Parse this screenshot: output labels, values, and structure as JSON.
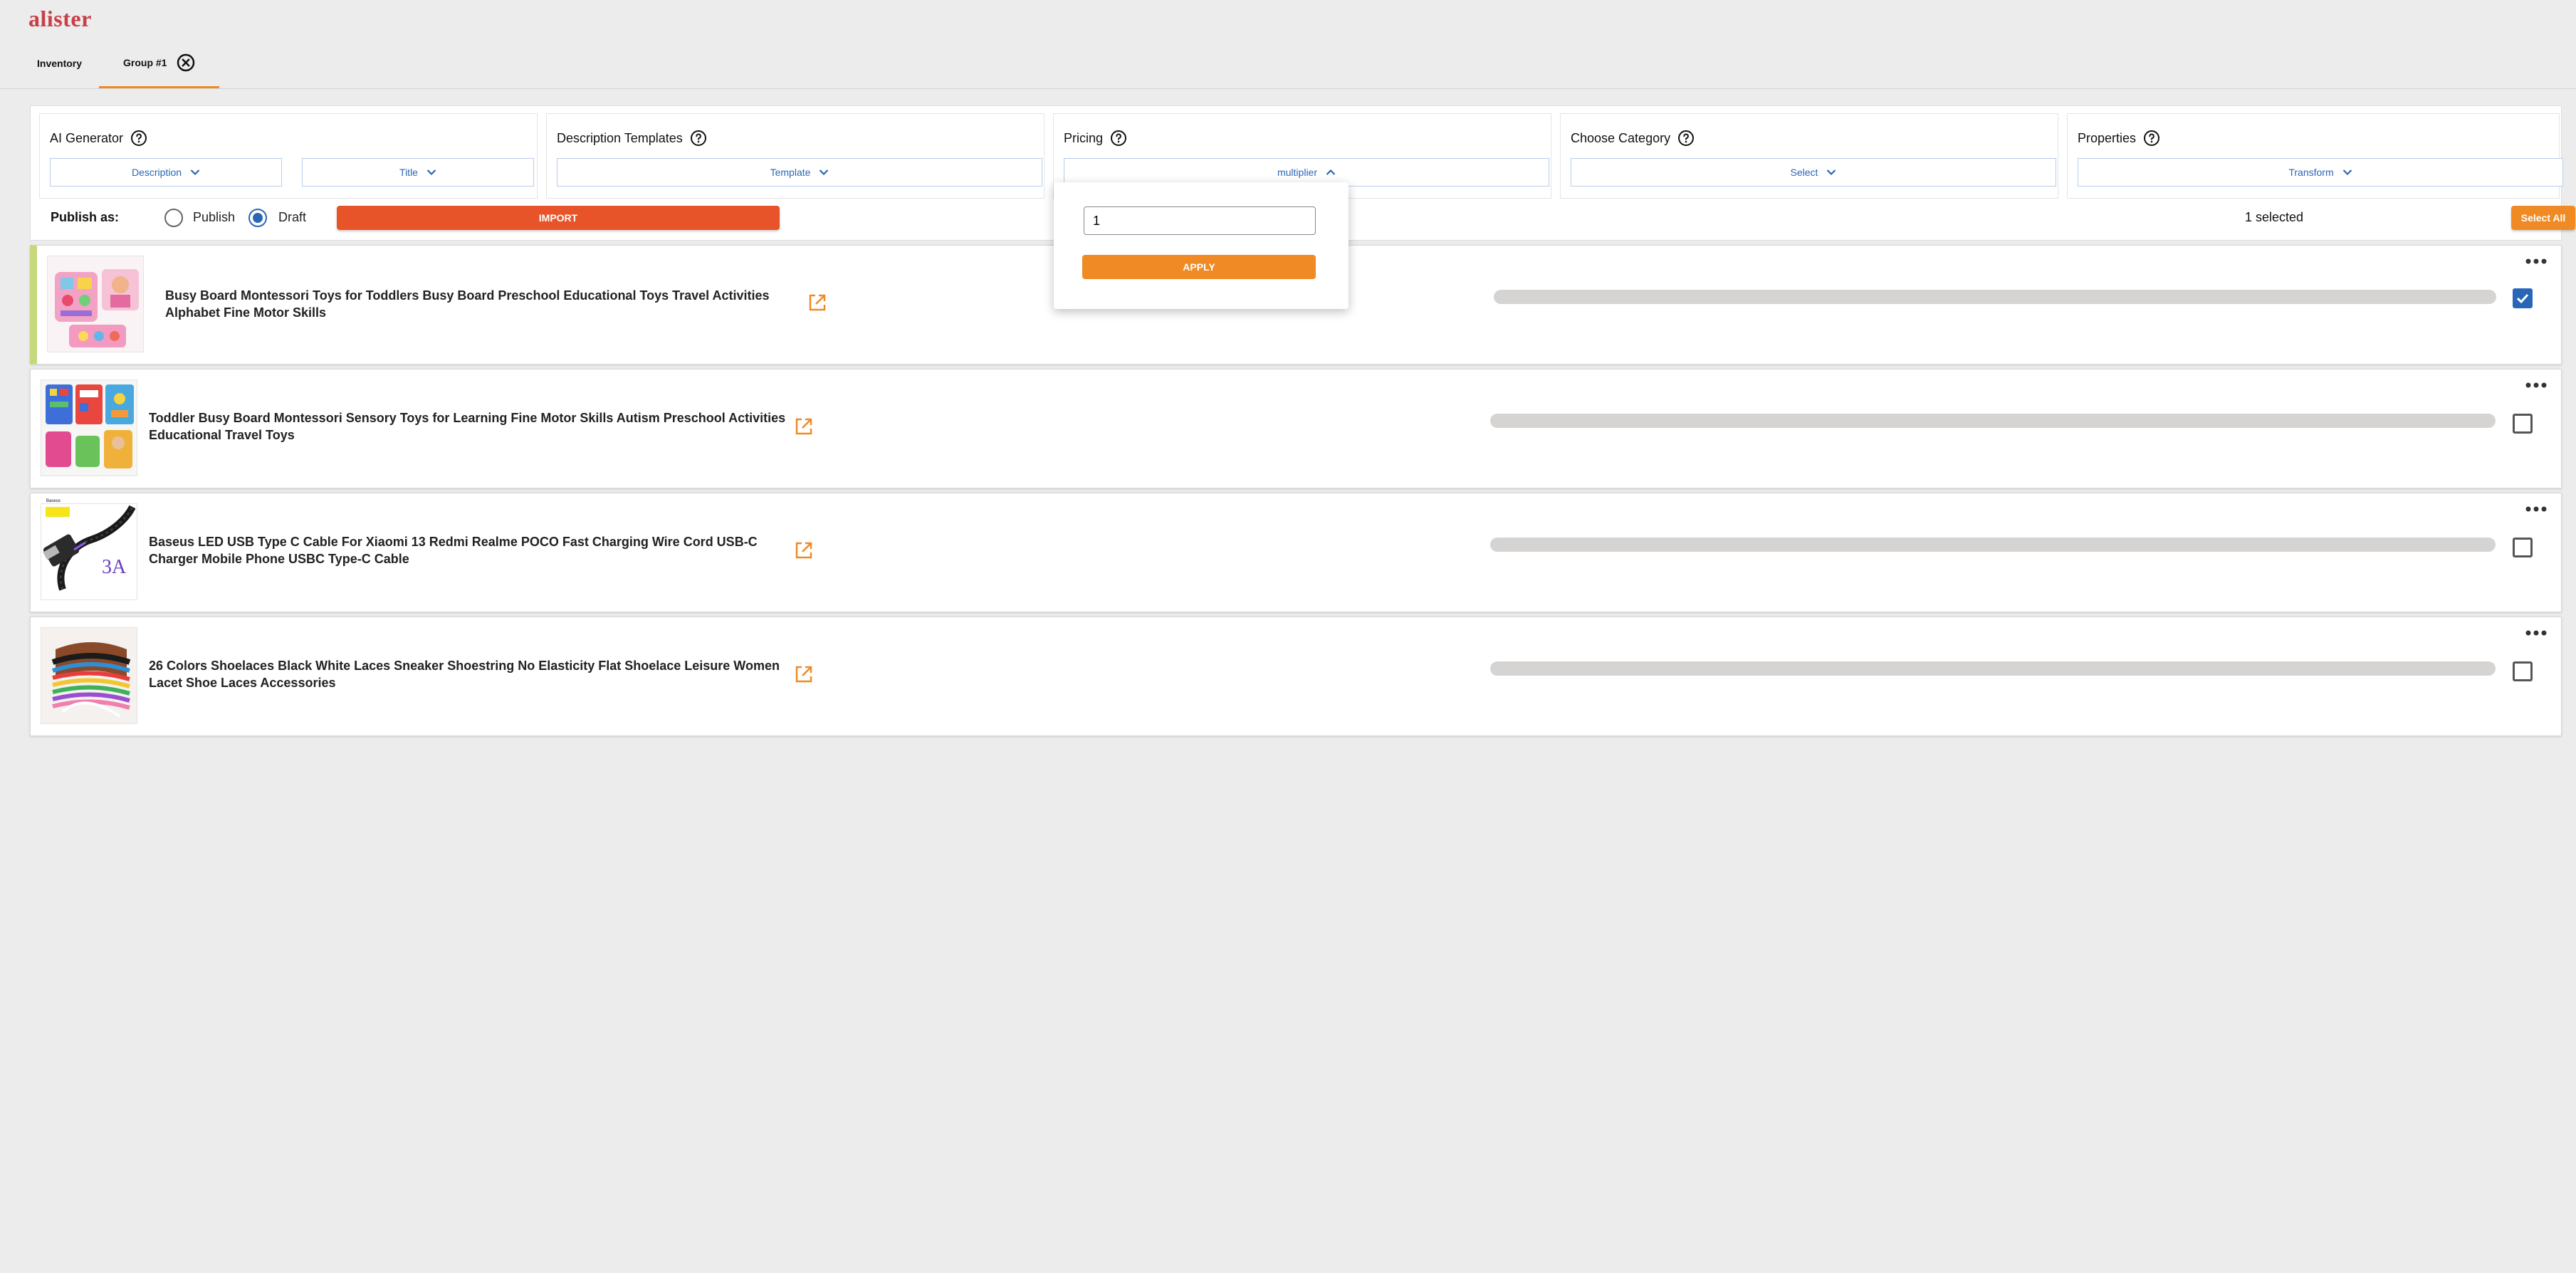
{
  "app": {
    "logo": "alister"
  },
  "tabs": [
    {
      "label": "Inventory",
      "active": false
    },
    {
      "label": "Group #1",
      "active": true,
      "closable": true
    }
  ],
  "controls": {
    "ai_generator": {
      "title": "AI Generator",
      "dropdowns": [
        "Description",
        "Title"
      ]
    },
    "description_templates": {
      "title": "Description Templates",
      "dropdown": "Template"
    },
    "pricing": {
      "title": "Pricing",
      "dropdown": "multiplier",
      "open": true
    },
    "choose_category": {
      "title": "Choose Category",
      "dropdown": "Select"
    },
    "properties": {
      "title": "Properties",
      "dropdown": "Transform"
    }
  },
  "publish": {
    "label": "Publish as:",
    "options": [
      {
        "label": "Publish",
        "checked": false
      },
      {
        "label": "Draft",
        "checked": true
      }
    ],
    "import_label": "IMPORT",
    "selected_count": "1 selected",
    "select_all_label": "Select All"
  },
  "pricing_popover": {
    "value": "1",
    "apply_label": "APPLY"
  },
  "items": [
    {
      "title_line1": "Busy Board Montessori Toys for Toddlers Busy Board Preschool Educational Toys Travel Activities",
      "title_line2": "Alphabet Fine Motor Skills",
      "checked": true,
      "highlight": true,
      "progress": 0
    },
    {
      "title_line1": "Toddler Busy Board Montessori Sensory Toys for Learning Fine Motor Skills Autism Preschool Activities",
      "title_line2": "Educational Travel Toys",
      "checked": false,
      "highlight": false,
      "progress": 0
    },
    {
      "title_line1": "Baseus LED USB Type C Cable For Xiaomi 13 Redmi Realme POCO Fast Charging Wire Cord USB-C",
      "title_line2": "Charger Mobile Phone USBC Type-C Cable",
      "checked": false,
      "highlight": false,
      "progress": 0,
      "thumb_badge": "Baseus",
      "thumb_text": "3A"
    },
    {
      "title_line1": "26 Colors Shoelaces Black White Laces Sneaker Shoestring No Elasticity Flat Shoelace Leisure Women",
      "title_line2": "Lacet Shoe Laces Accessories",
      "checked": false,
      "highlight": false,
      "progress": 0
    }
  ],
  "colors": {
    "accent_orange": "#f08a24",
    "import_red": "#e8542a",
    "link_blue": "#2a66b8",
    "logo_red": "#c83f48",
    "highlight_green": "#c5d97a"
  }
}
